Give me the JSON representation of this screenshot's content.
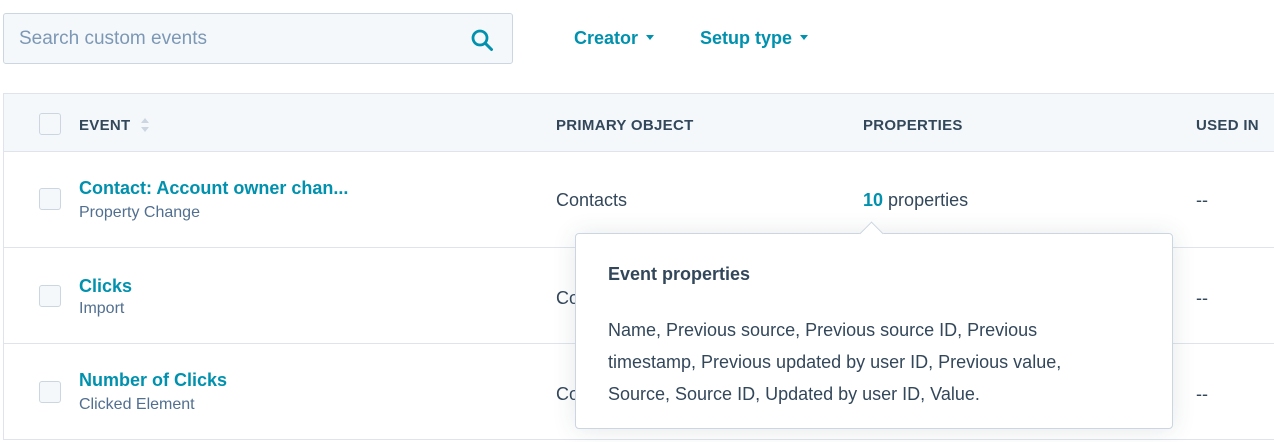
{
  "search": {
    "placeholder": "Search custom events",
    "value": ""
  },
  "filters": {
    "creator_label": "Creator",
    "setup_type_label": "Setup type"
  },
  "table": {
    "columns": {
      "event": "EVENT",
      "primary_object": "PRIMARY OBJECT",
      "properties": "PROPERTIES",
      "used_in": "USED IN"
    },
    "rows": [
      {
        "name": "Contact: Account owner chan...",
        "type": "Property Change",
        "primary_object": "Contacts",
        "properties_count": "10",
        "properties_label": "properties",
        "used_in": "--"
      },
      {
        "name": "Clicks",
        "type": "Import",
        "primary_object": "Co",
        "used_in": "--"
      },
      {
        "name": "Number of Clicks",
        "type": "Clicked Element",
        "primary_object": "Co",
        "used_in": "--"
      }
    ]
  },
  "popover": {
    "title": "Event properties",
    "body": "Name, Previous source, Previous source ID, Previous timestamp, Previous updated by user ID, Previous value, Source, Source ID, Updated by user ID, Value."
  },
  "colors": {
    "link": "#0091ae",
    "text": "#33475b",
    "subtext": "#516f90",
    "header_bg": "#f5f8fa",
    "border": "#dfe3eb"
  },
  "icons": {
    "search": "search-icon",
    "sort": "sort-icon",
    "caret": "chevron-down-icon"
  }
}
